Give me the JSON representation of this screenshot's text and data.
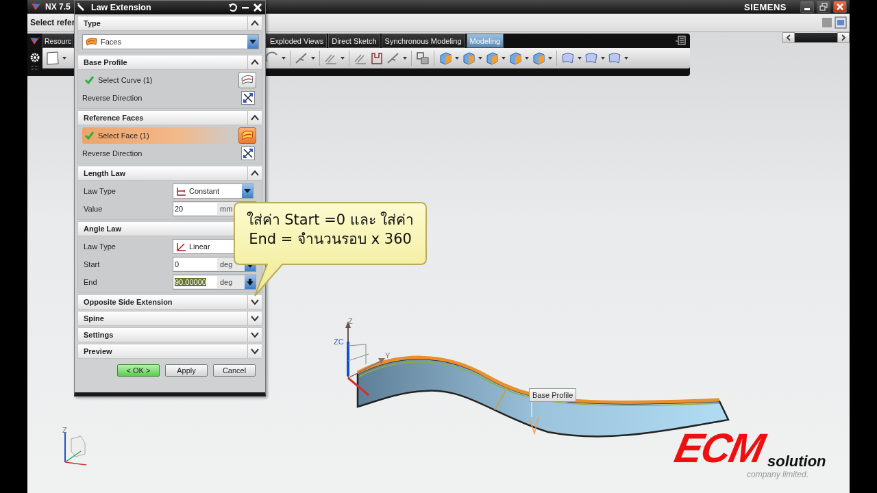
{
  "window": {
    "title": "NX 7.5",
    "brand": "SIEMENS"
  },
  "cue_line": "Select refer",
  "toolbar": {
    "tabs": [
      {
        "label": "Resourc",
        "selected": false
      },
      {
        "label": "Exploded Views",
        "selected": false
      },
      {
        "label": "Direct Sketch",
        "selected": false
      },
      {
        "label": "Synchronous Modeling",
        "selected": false
      },
      {
        "label": "Modeling",
        "selected": true
      }
    ]
  },
  "dialog": {
    "title": "Law Extension",
    "sections": [
      {
        "title": "Type",
        "expanded": true,
        "rows": [
          {
            "kind": "dropdown",
            "value": "Faces"
          }
        ]
      },
      {
        "title": "Base Profile",
        "expanded": true,
        "rows": [
          {
            "kind": "selection",
            "label": "Select Curve (1)",
            "done": true,
            "selected": false
          },
          {
            "kind": "action",
            "label": "Reverse Direction"
          }
        ]
      },
      {
        "title": "Reference Faces",
        "expanded": true,
        "rows": [
          {
            "kind": "selection",
            "label": "Select Face (1)",
            "done": true,
            "selected": true
          },
          {
            "kind": "action",
            "label": "Reverse Direction"
          }
        ]
      },
      {
        "title": "Length Law",
        "expanded": true,
        "rows": [
          {
            "kind": "choice",
            "label": "Law Type",
            "value": "Constant"
          },
          {
            "kind": "number",
            "label": "Value",
            "value": "20",
            "unit": "mm",
            "spinner": false,
            "highlighted": false
          }
        ]
      },
      {
        "title": "Angle Law",
        "expanded": true,
        "rows": [
          {
            "kind": "choice",
            "label": "Law Type",
            "value": "Linear"
          },
          {
            "kind": "number",
            "label": "Start",
            "value": "0",
            "unit": "deg",
            "spinner": true,
            "highlighted": false
          },
          {
            "kind": "number",
            "label": "End",
            "value": "90.00000",
            "unit": "deg",
            "spinner": true,
            "highlighted": true
          }
        ]
      },
      {
        "title": "Opposite Side Extension",
        "expanded": false
      },
      {
        "title": "Spine",
        "expanded": false
      },
      {
        "title": "Settings",
        "expanded": false
      },
      {
        "title": "Preview",
        "expanded": false
      }
    ],
    "buttons": [
      {
        "label": "< OK >",
        "kind": "default"
      },
      {
        "label": "Apply",
        "kind": "normal"
      },
      {
        "label": "Cancel",
        "kind": "normal"
      }
    ]
  },
  "callout": {
    "lines": [
      "ใส่ค่า Start =0 และ ใส่ค่า",
      "End = จำนวนรอบ x 360"
    ]
  },
  "viewport": {
    "triad_labels": [
      "Z",
      "ZC",
      "Y"
    ],
    "tooltip": "Base Profile",
    "view_triad_label": "Z"
  },
  "logo": {
    "main": "ECM",
    "sub": "solution",
    "tagline": "company limited."
  }
}
